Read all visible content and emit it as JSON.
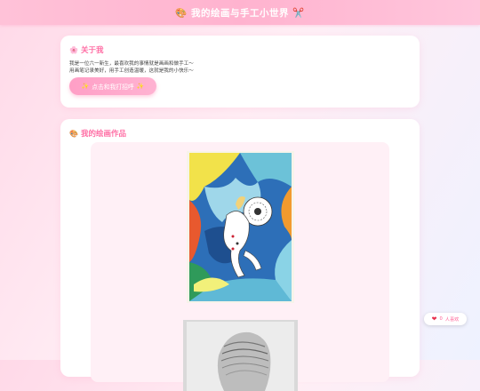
{
  "header": {
    "title": "🎨 我的绘画与手工小世界 ✂️"
  },
  "about": {
    "heading": "关于我",
    "line1": "我是一位六一新生，最喜欢我的事情就是画画和做手工～",
    "line2": "用画笔记录美好，用手工创造温暖，这就是我的小快乐～",
    "button_label": "点击和我打招呼"
  },
  "gallery": {
    "heading": "我的绘画作品"
  },
  "likes": {
    "count": "0",
    "label": "人喜欢"
  },
  "icons": {
    "header": "palette-icon",
    "about": "flower-icon",
    "gallery": "palette-icon",
    "button": "sparkle-icon",
    "like": "heart-icon"
  },
  "colors": {
    "accent": "#ff6fa5",
    "header": "#ffb3cf",
    "button": "#ff9fc6",
    "heart": "#e8324f"
  }
}
